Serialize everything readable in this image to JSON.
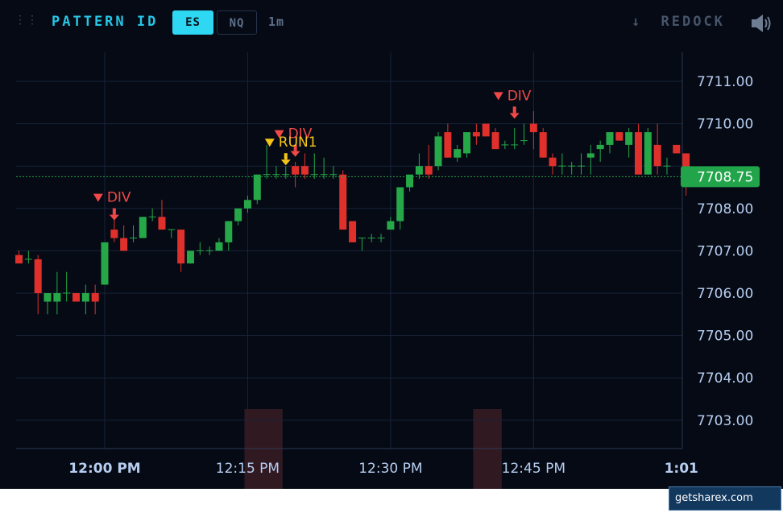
{
  "toolbar": {
    "grip_icon": "⋮⋮",
    "title": "PATTERN ID",
    "symbols": [
      "ES",
      "NQ"
    ],
    "active_symbol": "ES",
    "interval": "1m",
    "redock_label": "REDOCK",
    "redock_icon": "arrow-down-icon",
    "sound_icon": "speaker-icon"
  },
  "chart_data": {
    "type": "candlestick",
    "y_ticks": [
      "7711.00",
      "7710.00",
      "7708.00",
      "7707.00",
      "7706.00",
      "7705.00",
      "7704.00",
      "7703.00"
    ],
    "ylim": [
      7702.4,
      7711.7
    ],
    "x_ticks": [
      {
        "minute": 0,
        "label": "12:00 PM",
        "bold": true
      },
      {
        "minute": 15,
        "label": "12:15 PM",
        "bold": false
      },
      {
        "minute": 30,
        "label": "12:30 PM",
        "bold": false
      },
      {
        "minute": 45,
        "label": "12:45 PM",
        "bold": false
      },
      {
        "minute": 60.5,
        "label": "1:01",
        "bold": true
      }
    ],
    "last_price": "7708.75",
    "last_price_value": 7708.75,
    "colors": {
      "up": "#26a848",
      "down": "#e0302c",
      "last": "#21a44a",
      "div": "#f04848",
      "run": "#f5c518",
      "grid": "#18243a",
      "axis_text": "#b7cdf0"
    },
    "highlight_ranges": [
      [
        15,
        19
      ],
      [
        39,
        42
      ]
    ],
    "candles": [
      [
        -9,
        7706.9,
        7707.0,
        7706.7,
        7706.7
      ],
      [
        -8,
        7706.8,
        7707.0,
        7706.7,
        7706.8
      ],
      [
        -7,
        7706.8,
        7706.9,
        7705.5,
        7706.0
      ],
      [
        -6,
        7705.8,
        7706.0,
        7705.5,
        7706.0
      ],
      [
        -5,
        7705.8,
        7706.5,
        7705.5,
        7706.0
      ],
      [
        -4,
        7706.0,
        7706.5,
        7705.8,
        7706.0
      ],
      [
        -3,
        7706.0,
        7706.0,
        7705.8,
        7705.8
      ],
      [
        -2,
        7705.8,
        7706.2,
        7705.5,
        7706.0
      ],
      [
        -1,
        7706.0,
        7706.2,
        7705.5,
        7705.8
      ],
      [
        0,
        7706.2,
        7707.2,
        7706.2,
        7707.2
      ],
      [
        1,
        7707.5,
        7708.0,
        7707.2,
        7707.3
      ],
      [
        2,
        7707.3,
        7707.6,
        7707.0,
        7707.0
      ],
      [
        3,
        7707.3,
        7707.6,
        7707.2,
        7707.3
      ],
      [
        4,
        7707.3,
        7707.8,
        7707.3,
        7707.8
      ],
      [
        5,
        7707.8,
        7708.0,
        7707.7,
        7707.8
      ],
      [
        6,
        7707.8,
        7708.2,
        7707.7,
        7707.5
      ],
      [
        7,
        7707.5,
        7707.5,
        7707.3,
        7707.5
      ],
      [
        8,
        7707.5,
        7707.5,
        7706.5,
        7706.7
      ],
      [
        9,
        7706.7,
        7707.0,
        7706.7,
        7707.0
      ],
      [
        10,
        7707.0,
        7707.2,
        7706.9,
        7707.0
      ],
      [
        11,
        7707.0,
        7707.1,
        7706.9,
        7707.0
      ],
      [
        12,
        7707.0,
        7707.3,
        7707.0,
        7707.2
      ],
      [
        13,
        7707.2,
        7707.7,
        7707.0,
        7707.7
      ],
      [
        14,
        7707.7,
        7708.0,
        7707.6,
        7708.0
      ],
      [
        15,
        7708.0,
        7708.3,
        7707.9,
        7708.2
      ],
      [
        16,
        7708.2,
        7708.8,
        7708.1,
        7708.8
      ],
      [
        17,
        7708.8,
        7709.5,
        7708.7,
        7708.8
      ],
      [
        18,
        7708.8,
        7709.0,
        7708.7,
        7708.8
      ],
      [
        19,
        7708.8,
        7709.0,
        7708.7,
        7708.8
      ],
      [
        20,
        7709.0,
        7709.1,
        7708.5,
        7708.8
      ],
      [
        21,
        7709.0,
        7709.3,
        7708.7,
        7708.8
      ],
      [
        22,
        7708.8,
        7709.3,
        7708.7,
        7708.8
      ],
      [
        23,
        7708.8,
        7709.2,
        7708.7,
        7708.8
      ],
      [
        24,
        7708.8,
        7709.0,
        7708.7,
        7708.8
      ],
      [
        25,
        7708.8,
        7708.9,
        7707.5,
        7707.5
      ],
      [
        26,
        7707.7,
        7707.7,
        7707.2,
        7707.2
      ],
      [
        27,
        7707.3,
        7707.3,
        7707.0,
        7707.3
      ],
      [
        28,
        7707.3,
        7707.4,
        7707.2,
        7707.3
      ],
      [
        29,
        7707.3,
        7707.4,
        7707.2,
        7707.3
      ],
      [
        30,
        7707.5,
        7707.8,
        7707.5,
        7707.7
      ],
      [
        31,
        7707.7,
        7708.5,
        7707.5,
        7708.5
      ],
      [
        32,
        7708.5,
        7708.8,
        7708.4,
        7708.8
      ],
      [
        33,
        7708.8,
        7709.3,
        7708.7,
        7709.0
      ],
      [
        34,
        7709.0,
        7709.5,
        7708.7,
        7708.8
      ],
      [
        35,
        7709.0,
        7709.8,
        7708.9,
        7709.7
      ],
      [
        36,
        7709.8,
        7710.0,
        7709.2,
        7709.2
      ],
      [
        37,
        7709.2,
        7709.5,
        7709.1,
        7709.4
      ],
      [
        38,
        7709.3,
        7709.8,
        7709.2,
        7709.8
      ],
      [
        39,
        7709.8,
        7710.0,
        7709.5,
        7709.7
      ],
      [
        40,
        7710.0,
        7710.0,
        7709.7,
        7709.7
      ],
      [
        41,
        7709.8,
        7709.9,
        7709.4,
        7709.4
      ],
      [
        42,
        7709.5,
        7709.6,
        7709.4,
        7709.5
      ],
      [
        43,
        7709.5,
        7709.9,
        7709.4,
        7709.5
      ],
      [
        44,
        7709.6,
        7710.0,
        7709.5,
        7709.6
      ],
      [
        45,
        7710.0,
        7710.3,
        7709.4,
        7709.8
      ],
      [
        46,
        7709.8,
        7709.9,
        7709.2,
        7709.2
      ],
      [
        47,
        7709.2,
        7709.3,
        7708.8,
        7709.0
      ],
      [
        48,
        7709.0,
        7709.3,
        7708.8,
        7709.0
      ],
      [
        49,
        7709.0,
        7709.1,
        7708.8,
        7709.0
      ],
      [
        50,
        7709.0,
        7709.3,
        7708.8,
        7709.0
      ],
      [
        51,
        7709.2,
        7709.5,
        7708.8,
        7709.3
      ],
      [
        52,
        7709.4,
        7709.6,
        7709.1,
        7709.5
      ],
      [
        53,
        7709.5,
        7709.8,
        7709.3,
        7709.8
      ],
      [
        54,
        7709.8,
        7709.8,
        7709.6,
        7709.6
      ],
      [
        55,
        7709.5,
        7709.9,
        7709.2,
        7709.8
      ],
      [
        56,
        7709.8,
        7710.0,
        7709.2,
        7708.8
      ],
      [
        57,
        7708.8,
        7709.9,
        7708.8,
        7709.8
      ],
      [
        58,
        7709.5,
        7710.0,
        7708.8,
        7709.0
      ],
      [
        59,
        7709.0,
        7709.2,
        7708.8,
        7709.0
      ],
      [
        60,
        7709.5,
        7709.5,
        7709.3,
        7709.3
      ],
      [
        61,
        7709.3,
        7709.3,
        7708.3,
        7708.8
      ]
    ],
    "annotations": [
      {
        "minute": 1,
        "label": "DIV",
        "kind": "div",
        "marker_price": 7707.7
      },
      {
        "minute": 20,
        "label": "DIV",
        "kind": "div",
        "marker_price": 7709.2
      },
      {
        "minute": 19,
        "label": "RUN1",
        "kind": "run",
        "marker_price": 7709.0
      },
      {
        "minute": 43,
        "label": "DIV",
        "kind": "div",
        "marker_price": 7710.1
      }
    ]
  },
  "footer": {
    "watermark": "getsharex.com"
  }
}
